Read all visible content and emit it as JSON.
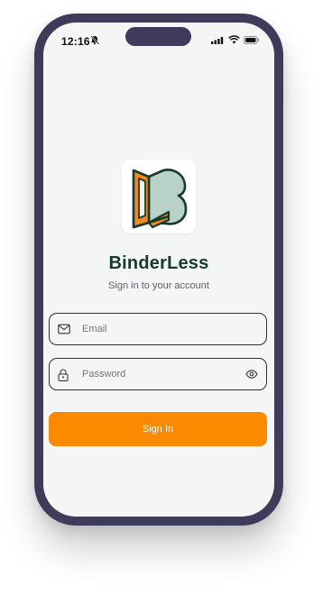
{
  "status_bar": {
    "time": "12:16",
    "icons": [
      "bell-slash-icon",
      "cellular-signal-icon",
      "wifi-icon",
      "battery-icon"
    ]
  },
  "app": {
    "name": "BinderLess",
    "subtitle": "Sign in to your account",
    "logo": "binderless-logo"
  },
  "form": {
    "email_placeholder": "Email",
    "password_placeholder": "Password",
    "email_icon": "mail-icon",
    "password_icon": "lock-icon",
    "toggle_icon": "eye-icon",
    "submit_label": "Sign In"
  },
  "colors": {
    "accent": "#fb8a00",
    "brand_dark": "#163a2c",
    "logo_green": "#b9d2c8",
    "device_frame": "#3f3b5a",
    "screen_bg": "#f4f5f5"
  }
}
